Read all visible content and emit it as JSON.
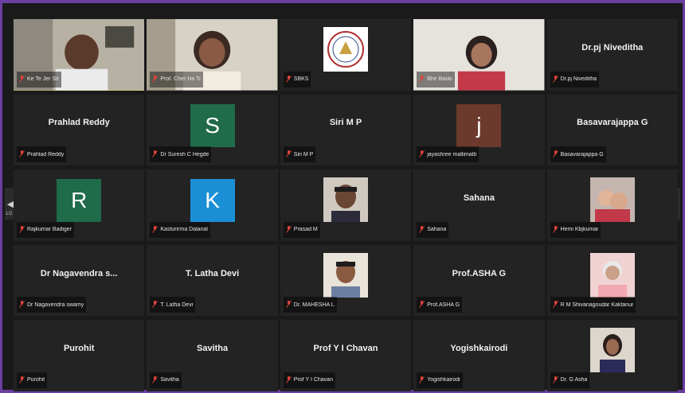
{
  "pagination": {
    "page": "1/2"
  },
  "tiles": [
    {
      "kind": "video",
      "scene": "man",
      "label": "Ke Te Jer Sit",
      "active": true
    },
    {
      "kind": "video",
      "scene": "woman1",
      "label": "Prof. Cher Ha Tr"
    },
    {
      "kind": "logo",
      "label": "SBKS"
    },
    {
      "kind": "video",
      "scene": "woman2",
      "label": "Bhe Baski"
    },
    {
      "kind": "name",
      "name": "Dr.pj Niveditha",
      "label": "Dr.pj Niveditha"
    },
    {
      "kind": "name",
      "name": "Prahlad Reddy",
      "label": "Prahlad Reddy"
    },
    {
      "kind": "avatar",
      "letter": "S",
      "color": "#1f6b4a",
      "label": "Dr Suresh C Hegde"
    },
    {
      "kind": "name",
      "name": "Siri M P",
      "label": "Siri M P"
    },
    {
      "kind": "avatar",
      "letter": "j",
      "color": "#6b3a2c",
      "label": "jayashree mallimatti"
    },
    {
      "kind": "name",
      "name": "Basavarajappa G",
      "label": "Basavarajappa G"
    },
    {
      "kind": "avatar",
      "letter": "R",
      "color": "#1f6b4a",
      "label": "Rajkumar Badiger"
    },
    {
      "kind": "avatar",
      "letter": "K",
      "color": "#1a8fd6",
      "label": "Kasturirma Dalanal"
    },
    {
      "kind": "photo",
      "scene": "man2",
      "label": "Prasad M"
    },
    {
      "kind": "name",
      "name": "Sahana",
      "label": "Sahana"
    },
    {
      "kind": "photo",
      "scene": "kids",
      "label": "Hemi Kbjkumar"
    },
    {
      "kind": "name",
      "name": "Dr Nagavendra s...",
      "label": "Dr Nagavendra swamy"
    },
    {
      "kind": "name",
      "name": "T. Latha Devi",
      "label": "T. Latha Devi"
    },
    {
      "kind": "photo",
      "scene": "man3",
      "label": "Dr. MAHESHA L"
    },
    {
      "kind": "name",
      "name": "Prof.ASHA G",
      "label": "Prof.ASHA G"
    },
    {
      "kind": "photo",
      "scene": "elder",
      "label": "R M Shivanagoudar Kaktanur"
    },
    {
      "kind": "name",
      "name": "Purohit",
      "label": "Purohit"
    },
    {
      "kind": "name",
      "name": "Savitha",
      "label": "Savitha"
    },
    {
      "kind": "name",
      "name": "Prof Y I Chavan",
      "label": "Prof Y I Chavan"
    },
    {
      "kind": "name",
      "name": "Yogishkairodi",
      "label": "Yogishkairodi"
    },
    {
      "kind": "photo",
      "scene": "woman3",
      "label": "Dr. G Asha"
    }
  ],
  "colors": {
    "mic_muted": "#e0443a",
    "active_border": "#d6e34a",
    "frame": "#6a3fa0"
  }
}
